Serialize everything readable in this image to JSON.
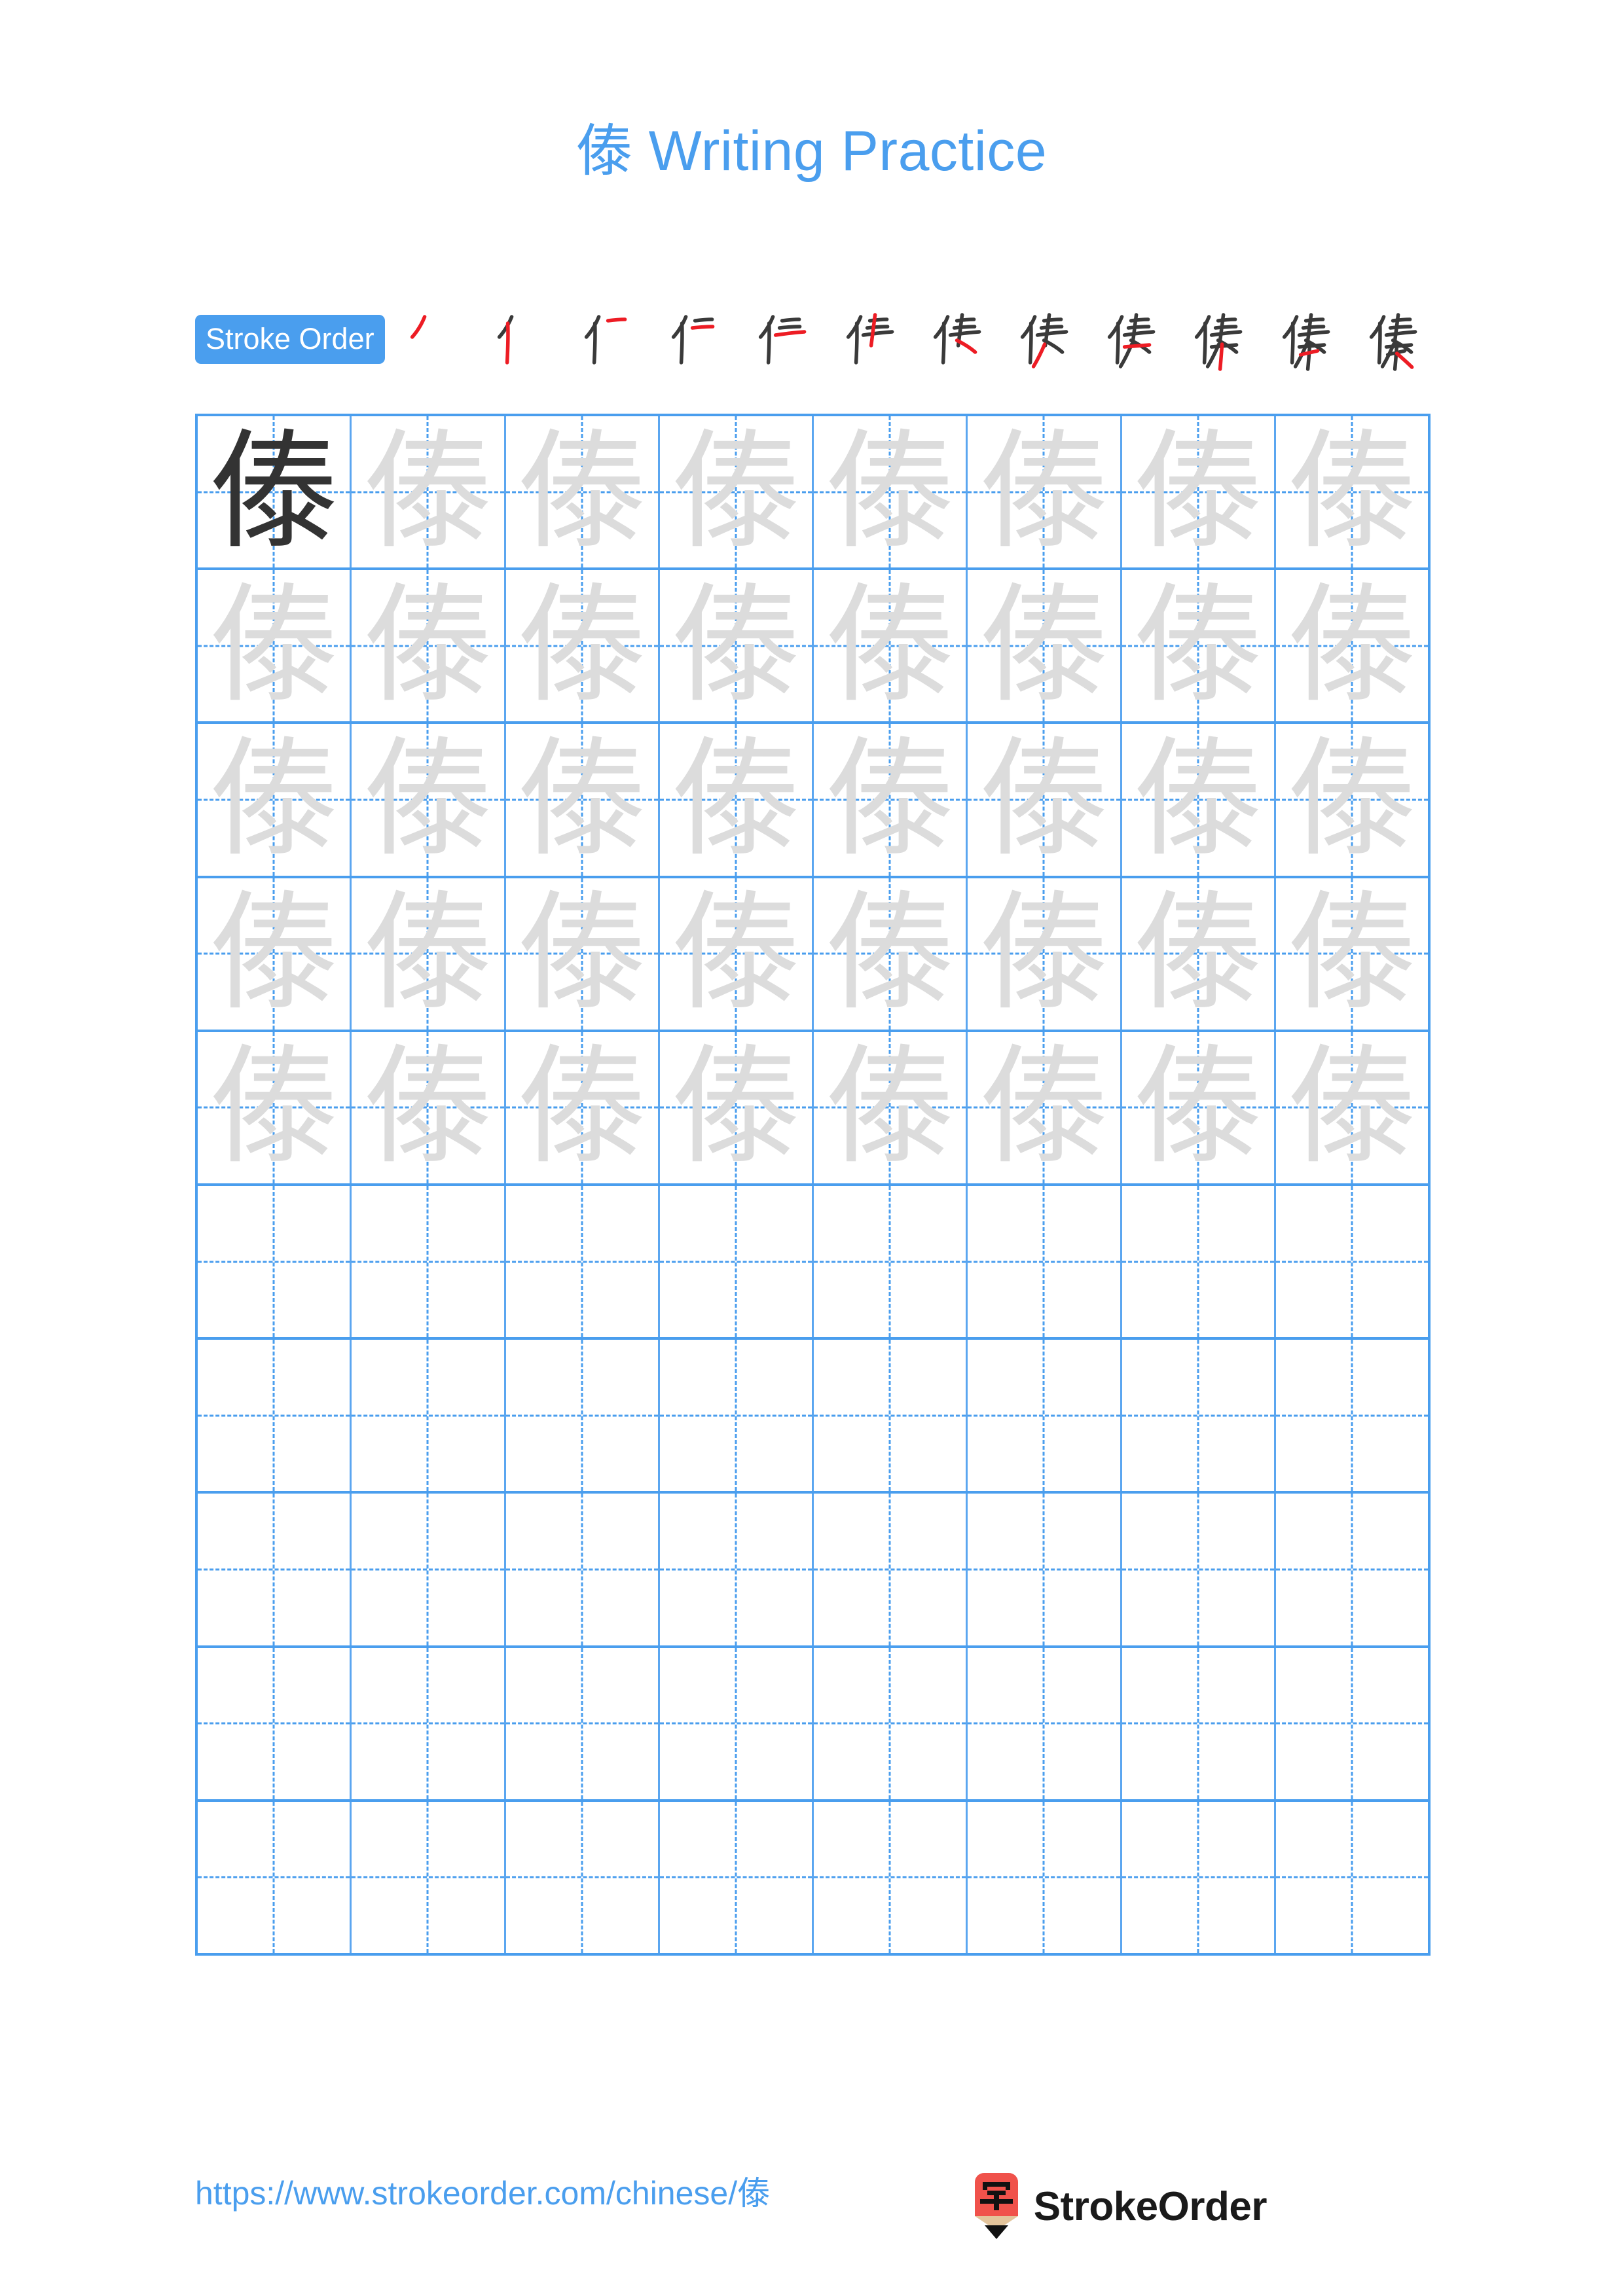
{
  "page": {
    "character": "傣",
    "title": "傣 Writing Practice",
    "title_char": "傣",
    "title_suffix": " Writing Practice",
    "background_color": "#FFFFFF",
    "accent_color": "#4A9EEE",
    "model_char_color": "#333333",
    "trace_char_color": "#DCDCDC",
    "stroke_highlight_color": "#ED1C24",
    "stroke_done_color": "#3A3A3A"
  },
  "stroke_order": {
    "badge_label": "Stroke Order",
    "total_strokes": 12,
    "steps": [
      {
        "index": 1,
        "partial": "丿"
      },
      {
        "index": 2,
        "partial": "亻"
      },
      {
        "index": 3,
        "partial": "𠂉"
      },
      {
        "index": 4,
        "partial": "仁"
      },
      {
        "index": 5,
        "partial": "仨"
      },
      {
        "index": 6,
        "partial": "伫"
      },
      {
        "index": 7,
        "partial": "佚"
      },
      {
        "index": 8,
        "partial": "倐"
      },
      {
        "index": 9,
        "partial": "傣"
      },
      {
        "index": 10,
        "partial": "傣"
      },
      {
        "index": 11,
        "partial": "傣"
      },
      {
        "index": 12,
        "partial": "傣"
      }
    ]
  },
  "grid": {
    "columns": 8,
    "rows": 10,
    "border_color": "#4A9EEE",
    "guide_color": "#4A9EEE",
    "rows_data": [
      {
        "row": 1,
        "cells": [
          "傣",
          "傣",
          "傣",
          "傣",
          "傣",
          "傣",
          "傣",
          "傣"
        ],
        "first_is_model": true
      },
      {
        "row": 2,
        "cells": [
          "傣",
          "傣",
          "傣",
          "傣",
          "傣",
          "傣",
          "傣",
          "傣"
        ],
        "first_is_model": false
      },
      {
        "row": 3,
        "cells": [
          "傣",
          "傣",
          "傣",
          "傣",
          "傣",
          "傣",
          "傣",
          "傣"
        ],
        "first_is_model": false
      },
      {
        "row": 4,
        "cells": [
          "傣",
          "傣",
          "傣",
          "傣",
          "傣",
          "傣",
          "傣",
          "傣"
        ],
        "first_is_model": false
      },
      {
        "row": 5,
        "cells": [
          "傣",
          "傣",
          "傣",
          "傣",
          "傣",
          "傣",
          "傣",
          "傣"
        ],
        "first_is_model": false
      },
      {
        "row": 6,
        "cells": [
          "",
          "",
          "",
          "",
          "",
          "",
          "",
          ""
        ],
        "first_is_model": false
      },
      {
        "row": 7,
        "cells": [
          "",
          "",
          "",
          "",
          "",
          "",
          "",
          ""
        ],
        "first_is_model": false
      },
      {
        "row": 8,
        "cells": [
          "",
          "",
          "",
          "",
          "",
          "",
          "",
          ""
        ],
        "first_is_model": false
      },
      {
        "row": 9,
        "cells": [
          "",
          "",
          "",
          "",
          "",
          "",
          "",
          ""
        ],
        "first_is_model": false
      },
      {
        "row": 10,
        "cells": [
          "",
          "",
          "",
          "",
          "",
          "",
          "",
          ""
        ],
        "first_is_model": false
      }
    ]
  },
  "footer": {
    "url": "https://www.strokeorder.com/chinese/傣",
    "brand_name": "StrokeOrder",
    "logo_icon": "pencil-logo-icon",
    "logo_glyph": "字",
    "logo_body_color": "#F0524B",
    "logo_wood_color": "#E3C49B",
    "logo_tip_color": "#111111"
  }
}
